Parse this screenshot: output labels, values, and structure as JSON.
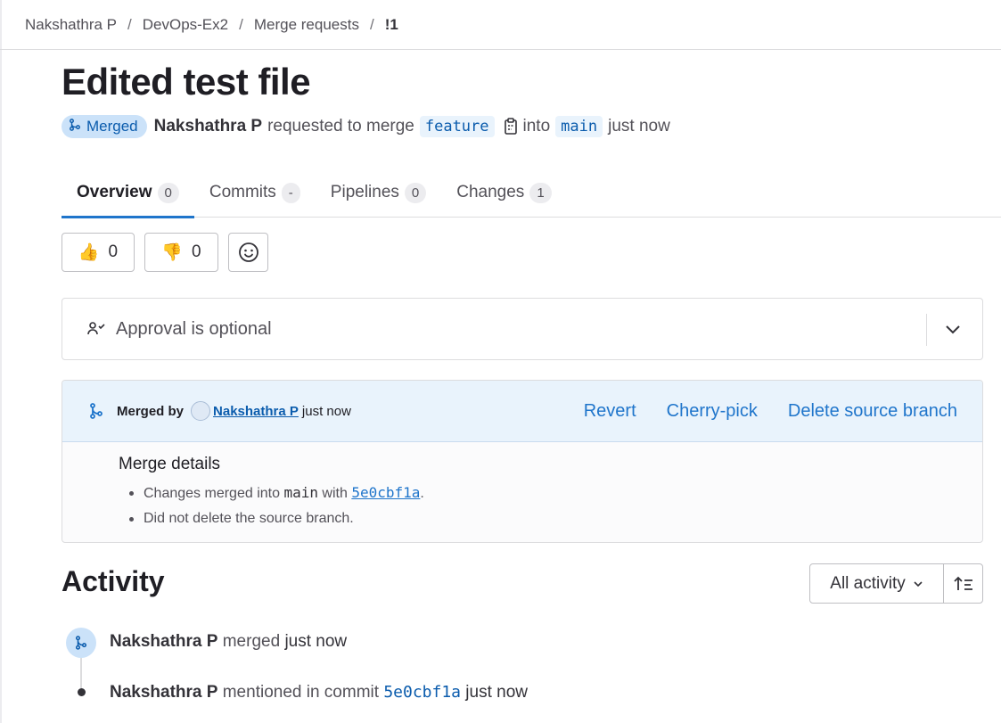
{
  "breadcrumb": {
    "items": [
      "Nakshathra P",
      "DevOps-Ex2",
      "Merge requests",
      "!1"
    ],
    "separator": "/"
  },
  "mr": {
    "title": "Edited test file",
    "status": "Merged",
    "author": "Nakshathra P",
    "action_text": "requested to merge",
    "source_branch": "feature",
    "into_text": "into",
    "target_branch": "main",
    "time": "just now"
  },
  "tabs": [
    {
      "label": "Overview",
      "count": "0",
      "active": true
    },
    {
      "label": "Commits",
      "count": "-"
    },
    {
      "label": "Pipelines",
      "count": "0"
    },
    {
      "label": "Changes",
      "count": "1"
    }
  ],
  "reactions": {
    "thumbs_up": {
      "icon": "👍",
      "count": "0"
    },
    "thumbs_down": {
      "icon": "👎",
      "count": "0"
    }
  },
  "approval": {
    "label": "Approval is optional"
  },
  "merge_widget": {
    "merged_by_label": "Merged by",
    "merged_by_user": "Nakshathra P",
    "time": "just now",
    "actions": [
      "Revert",
      "Cherry-pick",
      "Delete source branch"
    ],
    "details_title": "Merge details",
    "line1_prefix": "Changes merged into",
    "line1_branch": "main",
    "line1_with": "with",
    "line1_sha": "5e0cbf1a",
    "line1_suffix": ".",
    "line2": "Did not delete the source branch."
  },
  "activity": {
    "title": "Activity",
    "filter_label": "All activity",
    "entries": [
      {
        "author": "Nakshathra P",
        "action": "merged",
        "time": "just now"
      },
      {
        "author": "Nakshathra P",
        "action": "mentioned in commit",
        "sha": "5e0cbf1a",
        "time": "just now"
      }
    ]
  },
  "colors": {
    "accent": "#1f75cb",
    "merged_badge_bg": "#cbe2f9",
    "widget_header_bg": "#e9f3fc"
  }
}
